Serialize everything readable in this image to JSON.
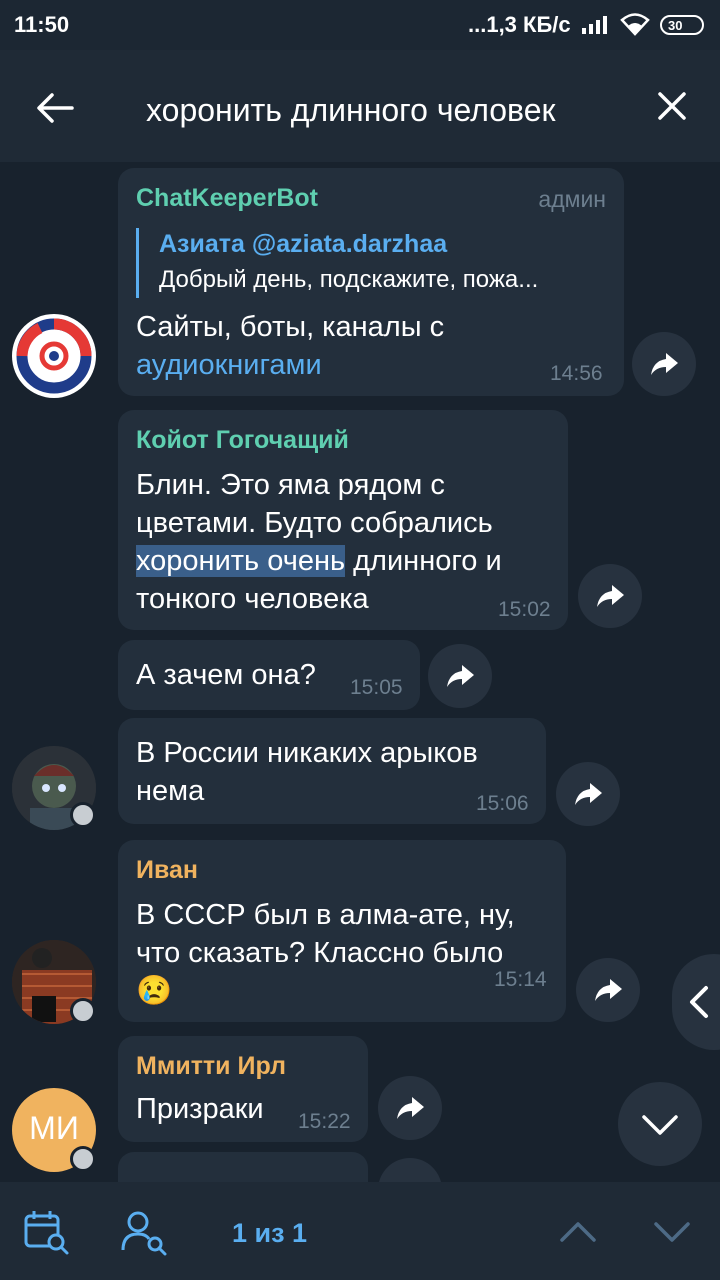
{
  "status": {
    "time": "11:50",
    "speed": "...1,3 КБ/с",
    "battery": "30"
  },
  "search": {
    "query": "хоронить длинного человек"
  },
  "messages": [
    {
      "sender": "ChatKeeperBot",
      "role": "админ",
      "quote_author": "Азиата @aziata.darzhaa",
      "quote_text": "Добрый день, подскажите, пожа...",
      "text_line1": "Сайты, боты, каналы с",
      "text_link": "аудиокнигами",
      "time": "14:56"
    },
    {
      "sender": "Койот Гогочащий",
      "line1": "Блин. Это яма рядом с",
      "line2": "цветами. Будто собрались",
      "line3_highlight": "хоронить очень",
      "line3_rest": " длинного и",
      "line4": "тонкого человека",
      "time": "15:02"
    },
    {
      "text": "А зачем она?",
      "time": "15:05"
    },
    {
      "line1": "В России никаких арыков",
      "line2": "нема",
      "time": "15:06"
    },
    {
      "sender": "Иван",
      "line1": "В СССР был в алма-ате, ну,",
      "line2": "что сказать? Классно было",
      "emoji": "😢",
      "time": "15:14"
    },
    {
      "sender": "Ммитти Ирл",
      "text": "Призраки",
      "time": "15:22",
      "avatar_initials": "МИ"
    }
  ],
  "bottom": {
    "counter": "1 из 1"
  },
  "colors": {
    "background": "#18222d",
    "bubble": "#232f3c",
    "accent": "#5aaef0",
    "sender_green": "#5fcfb0",
    "sender_orange": "#f0b35f"
  },
  "icons": [
    "back-arrow-icon",
    "close-icon",
    "share-icon",
    "calendar-search-icon",
    "user-search-icon",
    "chevron-up-icon",
    "chevron-down-icon",
    "chevron-left-icon"
  ]
}
